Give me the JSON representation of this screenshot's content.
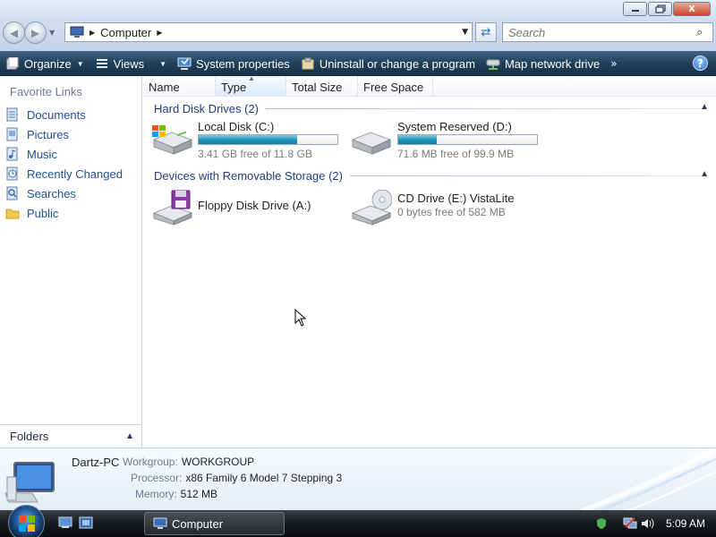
{
  "window": {
    "minimize_label": "",
    "maximize_label": "",
    "close_label": "X"
  },
  "address_bar": {
    "crumb": "Computer"
  },
  "search": {
    "placeholder": "Search"
  },
  "toolbar": {
    "organize": "Organize",
    "views": "Views",
    "system_properties": "System properties",
    "uninstall": "Uninstall or change a program",
    "map_network": "Map network drive",
    "more": "»",
    "help": "?"
  },
  "nav_pane": {
    "header": "Favorite Links",
    "items": [
      {
        "label": "Documents",
        "icon": "documents-icon"
      },
      {
        "label": "Pictures",
        "icon": "pictures-icon"
      },
      {
        "label": "Music",
        "icon": "music-icon"
      },
      {
        "label": "Recently Changed",
        "icon": "recently-changed-icon"
      },
      {
        "label": "Searches",
        "icon": "searches-icon"
      },
      {
        "label": "Public",
        "icon": "public-folder-icon"
      }
    ],
    "folders_label": "Folders"
  },
  "columns": [
    "Name",
    "Type",
    "Total Size",
    "Free Space"
  ],
  "groups": {
    "hard_disks": {
      "label": "Hard Disk Drives (2)",
      "drives": [
        {
          "name": "Local Disk (C:)",
          "free": "3.41 GB free of 11.8 GB",
          "used_fraction": 0.71
        },
        {
          "name": "System Reserved (D:)",
          "free": "71.6 MB free of 99.9 MB",
          "used_fraction": 0.28
        }
      ]
    },
    "removable": {
      "label": "Devices with Removable Storage (2)",
      "drives": [
        {
          "name": "Floppy Disk Drive (A:)",
          "free": ""
        },
        {
          "name": "CD Drive (E:) VistaLite",
          "free": "0 bytes free of 582 MB"
        }
      ]
    }
  },
  "details": {
    "pc_name": "Dartz-PC",
    "workgroup_key": "Workgroup:",
    "workgroup_val": "WORKGROUP",
    "processor_key": "Processor:",
    "processor_val": "x86 Family 6 Model 7 Stepping 3",
    "memory_key": "Memory:",
    "memory_val": "512 MB"
  },
  "taskbar": {
    "window_button": "Computer",
    "clock": "5:09 AM"
  },
  "colors": {
    "toolbar_bg": "#213f59",
    "link_text": "#1e4f98",
    "group_text": "#1e3e7a",
    "bar_fill": "#1d90b7"
  }
}
